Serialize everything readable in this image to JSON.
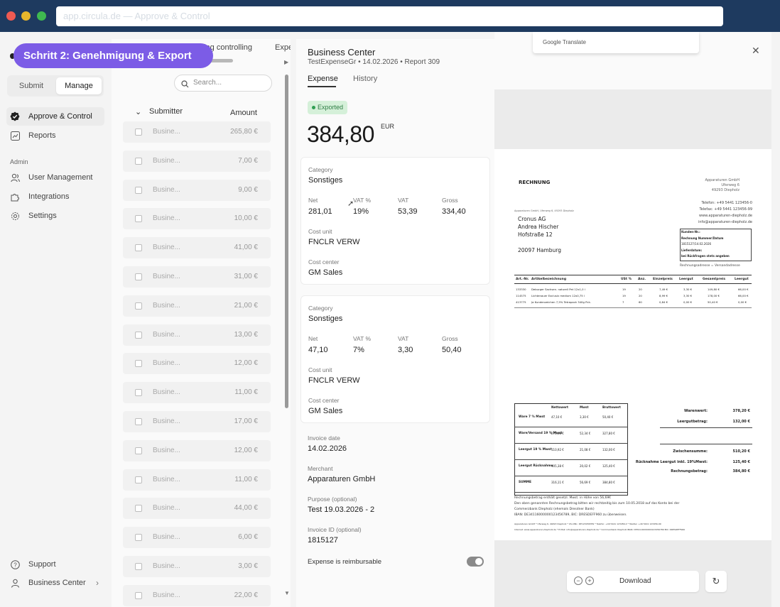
{
  "browser": {
    "url": "app.circula.de — Approve & Control"
  },
  "step_badge": "Schritt 2: Genehmigung & Export",
  "sidebar": {
    "segment": {
      "submit": "Submit",
      "manage": "Manage"
    },
    "items": [
      {
        "label": "Approve & Control",
        "icon": "check-badge-icon"
      },
      {
        "label": "Reports",
        "icon": "chart-icon"
      }
    ],
    "admin_label": "Admin",
    "admin_items": [
      {
        "label": "User Management",
        "icon": "users-icon"
      },
      {
        "label": "Integrations",
        "icon": "puzzle-icon"
      },
      {
        "label": "Settings",
        "icon": "gear-icon"
      }
    ],
    "support": "Support",
    "business_center": "Business Center"
  },
  "list": {
    "tabs": [
      "ding controlling",
      "Expe"
    ],
    "search_placeholder": "Search...",
    "col_submitter": "Submitter",
    "col_amount": "Amount",
    "rows": [
      {
        "name": "Busine...",
        "amount": "265,80 €"
      },
      {
        "name": "Busine...",
        "amount": "7,00 €"
      },
      {
        "name": "Busine...",
        "amount": "9,00 €"
      },
      {
        "name": "Busine...",
        "amount": "10,00 €"
      },
      {
        "name": "Busine...",
        "amount": "41,00 €"
      },
      {
        "name": "Busine...",
        "amount": "31,00 €"
      },
      {
        "name": "Busine...",
        "amount": "21,00 €"
      },
      {
        "name": "Busine...",
        "amount": "13,00 €"
      },
      {
        "name": "Busine...",
        "amount": "12,00 €"
      },
      {
        "name": "Busine...",
        "amount": "11,00 €"
      },
      {
        "name": "Busine...",
        "amount": "17,00 €"
      },
      {
        "name": "Busine...",
        "amount": "12,00 €"
      },
      {
        "name": "Busine...",
        "amount": "11,00 €"
      },
      {
        "name": "Busine...",
        "amount": "44,00 €"
      },
      {
        "name": "Busine...",
        "amount": "6,00 €"
      },
      {
        "name": "Busine...",
        "amount": "3,00 €"
      },
      {
        "name": "Busine...",
        "amount": "22,00 €"
      }
    ]
  },
  "detail": {
    "title": "Business Center",
    "subtitle": "TestExpenseGr • 14.02.2026 • Report 309",
    "tab_expense": "Expense",
    "tab_history": "History",
    "status": "Exported",
    "amount": "384,80",
    "currency": "EUR",
    "splits": [
      {
        "category_label": "Category",
        "category": "Sonstiges",
        "net_label": "Net",
        "net": "281,01",
        "vatp_label": "VAT %",
        "vatp": "19%",
        "vat_label": "VAT",
        "vat": "53,39",
        "gross_label": "Gross",
        "gross": "334,40",
        "costunit_label": "Cost unit",
        "costunit": "FNCLR VERW",
        "costcenter_label": "Cost center",
        "costcenter": "GM Sales"
      },
      {
        "category_label": "Category",
        "category": "Sonstiges",
        "net_label": "Net",
        "net": "47,10",
        "vatp_label": "VAT %",
        "vatp": "7%",
        "vat_label": "VAT",
        "vat": "3,30",
        "gross_label": "Gross",
        "gross": "50,40",
        "costunit_label": "Cost unit",
        "costunit": "FNCLR VERW",
        "costcenter_label": "Cost center",
        "costcenter": "GM Sales"
      }
    ],
    "invoice_date_label": "Invoice date",
    "invoice_date": "14.02.2026",
    "merchant_label": "Merchant",
    "merchant": "Apparaturen GmbH",
    "purpose_label": "Purpose (optional)",
    "purpose": "Test 19.03.2026 - 2",
    "invoice_id_label": "Invoice ID (optional)",
    "invoice_id": "1815127",
    "reimbursable_label": "Expense is reimbursable",
    "reimbursable": true
  },
  "preview": {
    "translate": "Google Translate",
    "download": "Download",
    "invoice": {
      "title": "RECHNUNG",
      "company": [
        "Apparaturen GmbH",
        "Uferweg 6",
        "49293 Diepholz"
      ],
      "contact": [
        "Telefon: +49 5441 123456-0",
        "Telefax: +49 5441 123456-99",
        "www.apparaturen-diepholz.de",
        "info@apparaturen-diepholz.de"
      ],
      "sender_line": "Apparaturen GmbH, Uferweg 6, 49293 Diepholz",
      "recipient": [
        "Cronus AG",
        "Andrea Hischer",
        "Hofstraße 12",
        "",
        "20097 Hamburg"
      ],
      "info_box": [
        "Kunden-Nr.:",
        "Rechnung Nummer/Datum",
        "1815127/14.02.2026",
        "Lieferdatum:",
        "bei Rückfragen stets angeben"
      ],
      "address_note": "Rechnungsadresse = Versandadresse",
      "table_headers": [
        "Art.-Nr.",
        "Artikelbezeichnung",
        "USt %",
        "Anz.",
        "Einzelpreis",
        "Leergut",
        "Gesamtpreis",
        "Leergut"
      ],
      "items": [
        [
          "133330",
          "Deburger Sachsen. naturell Pet 12x1,0 l",
          "19",
          "20",
          "7,49 €",
          "3,30 €",
          "149,80 €",
          "66,00 €"
        ],
        [
          "114575",
          "Lichtenauer Exclusiv medium 12x0,75 l",
          "19",
          "20",
          "8,99 €",
          "3,30 €",
          "178,00 €",
          "66,00 €"
        ],
        [
          "413775",
          "Ja Kundenzeichen 7,5% Tetrapack 340g Pck.",
          "7",
          "60",
          "0,84 €",
          "0,00 €",
          "50,40 €",
          "0,00 €"
        ]
      ],
      "summary_headers": [
        "",
        "Nettowert",
        "Mwst",
        "Bruttowert"
      ],
      "summary_rows": [
        [
          "Ware 7 % Mwst",
          "47,10 €",
          "3,30 €",
          "50,40 €"
        ],
        [
          "Ware/Versand 19 % Mwst",
          "275,46 €",
          "52,34 €",
          "327,80 €"
        ],
        [
          "Leergut 19 % Mwst",
          "110,92 €",
          "21,08 €",
          "132,00 €"
        ],
        [
          "Leergut Rücknahme",
          "105,38 €",
          "20,02 €",
          "125,40 €"
        ],
        [
          "SUMME",
          "316,11 €",
          "56,69 €",
          "384,80 €"
        ]
      ],
      "totals": [
        [
          "Warenwert:",
          "378,20 €"
        ],
        [
          "Leergutbetrag:",
          "132,00 €"
        ],
        [
          "Zwischensumme:",
          "510,20 €"
        ],
        [
          "Rücknahme Leergut inkl. 19%Mwst:",
          "125,40 €"
        ],
        [
          "Rechnungsbetrag:",
          "384,80 €"
        ]
      ],
      "footer": [
        "Rechnungsbetrag enthält gesetzl. Mwst. in Höhe von 56,69€",
        "Den oben genannten Rechnungsbetrag bitten wir rechtzeitig bis zum 10.05.2018 auf das Konto bei der",
        "Commerzbank Diepholz (ehemals Dresdner Bank)",
        "IBAN: DE34116000000123456789, BIC: DRESDEFF960 zu überweisen.",
        "Apparaturen GmbH * Uferweg 6, 49293 Diepholz * US-IdNr.: DE123456789 * Telefon: +49 5441 123456-0 * Telefax: +49 5441 123456-99",
        "Internet: www.apparaturen-diepholz.de * E-Mail: info@apparaturen-diepholz.de * Commerzbank Diepholz IBAN: DE34116000000123456789 BIC: DRESDEFF960"
      ]
    }
  },
  "colors": {
    "accent": "#7c5ce6",
    "status_bg": "#d5f0d9",
    "status_fg": "#2e7d44"
  }
}
